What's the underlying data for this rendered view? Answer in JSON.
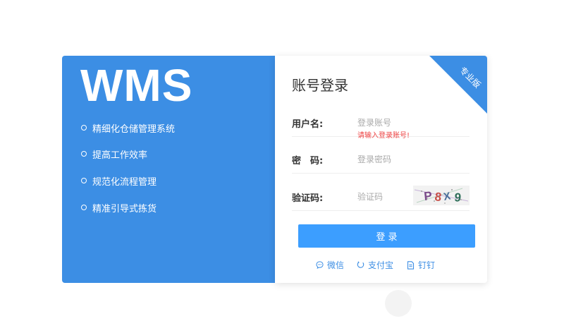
{
  "brand": {
    "logo": "WMS"
  },
  "features": [
    "精细化仓储管理系统",
    "提高工作效率",
    "规范化流程管理",
    "精准引导式拣货"
  ],
  "ribbon": {
    "label": "专业版"
  },
  "login": {
    "title": "账号登录",
    "username": {
      "label": "用户名:",
      "placeholder": "登录账号",
      "error": "请输入登录账号!"
    },
    "password": {
      "label": "密　码:",
      "placeholder": "登录密码"
    },
    "captcha": {
      "label": "验证码:",
      "placeholder": "验证码",
      "text": "P8X9"
    },
    "submit": "登 录"
  },
  "social": [
    {
      "label": "微信",
      "icon": "chat-bubble-icon"
    },
    {
      "label": "支付宝",
      "icon": "alipay-icon"
    },
    {
      "label": "钉钉",
      "icon": "document-icon"
    }
  ],
  "colors": {
    "primary": "#3c8ee4",
    "button": "#3c9eff",
    "error": "#ee4444"
  }
}
